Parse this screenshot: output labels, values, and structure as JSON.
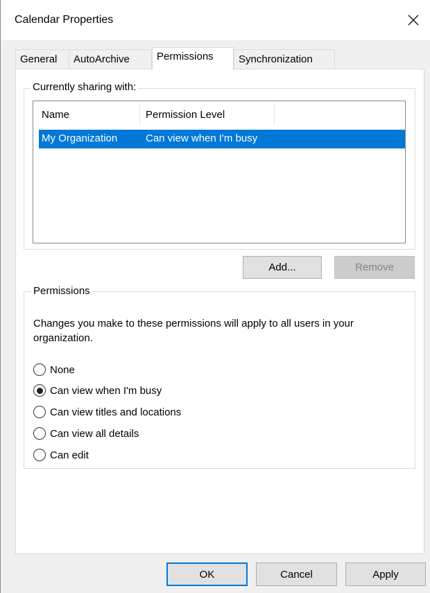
{
  "window": {
    "title": "Calendar Properties",
    "close_icon": "close-icon"
  },
  "tabs": [
    {
      "label": "General",
      "active": false
    },
    {
      "label": "AutoArchive",
      "active": false
    },
    {
      "label": "Permissions",
      "active": true
    },
    {
      "label": "Synchronization",
      "active": false
    }
  ],
  "sharing": {
    "group_label": "Currently sharing with:",
    "columns": [
      "Name",
      "Permission Level"
    ],
    "rows": [
      {
        "name": "My Organization",
        "permission": "Can view when I'm busy",
        "selected": true
      }
    ],
    "add_label": "Add...",
    "remove_label": "Remove"
  },
  "permissions": {
    "group_label": "Permissions",
    "description": "Changes you make to these permissions will apply to all users in your organization.",
    "options": [
      {
        "label": "None",
        "checked": false
      },
      {
        "label": "Can view when I'm busy",
        "checked": true
      },
      {
        "label": "Can view titles and locations",
        "checked": false
      },
      {
        "label": "Can view all details",
        "checked": false
      },
      {
        "label": "Can edit",
        "checked": false
      }
    ]
  },
  "footer": {
    "ok_label": "OK",
    "cancel_label": "Cancel",
    "apply_label": "Apply"
  },
  "colors": {
    "selection": "#0078d7",
    "dialog_bg": "#f0f0f0"
  }
}
